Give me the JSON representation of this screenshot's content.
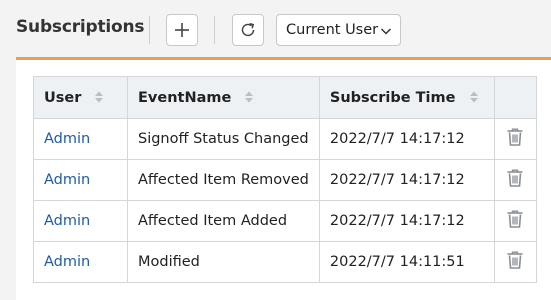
{
  "header": {
    "title": "Subscriptions",
    "filter_selected": "Current User"
  },
  "table": {
    "columns": [
      "User",
      "EventName",
      "Subscribe Time",
      ""
    ],
    "rows": [
      {
        "user": "Admin",
        "event": "Signoff Status Changed",
        "time": "2022/7/7 14:17:12"
      },
      {
        "user": "Admin",
        "event": "Affected Item Removed",
        "time": "2022/7/7 14:17:12"
      },
      {
        "user": "Admin",
        "event": "Affected Item Added",
        "time": "2022/7/7 14:17:12"
      },
      {
        "user": "Admin",
        "event": "Modified",
        "time": "2022/7/7 14:11:51"
      }
    ]
  },
  "colors": {
    "accent": "#f29b51",
    "link": "#1f5aa8",
    "header_bg": "#eef1f4"
  },
  "icons": [
    "plus-icon",
    "refresh-icon",
    "chevron-down-icon",
    "sort-icon",
    "trash-icon"
  ]
}
